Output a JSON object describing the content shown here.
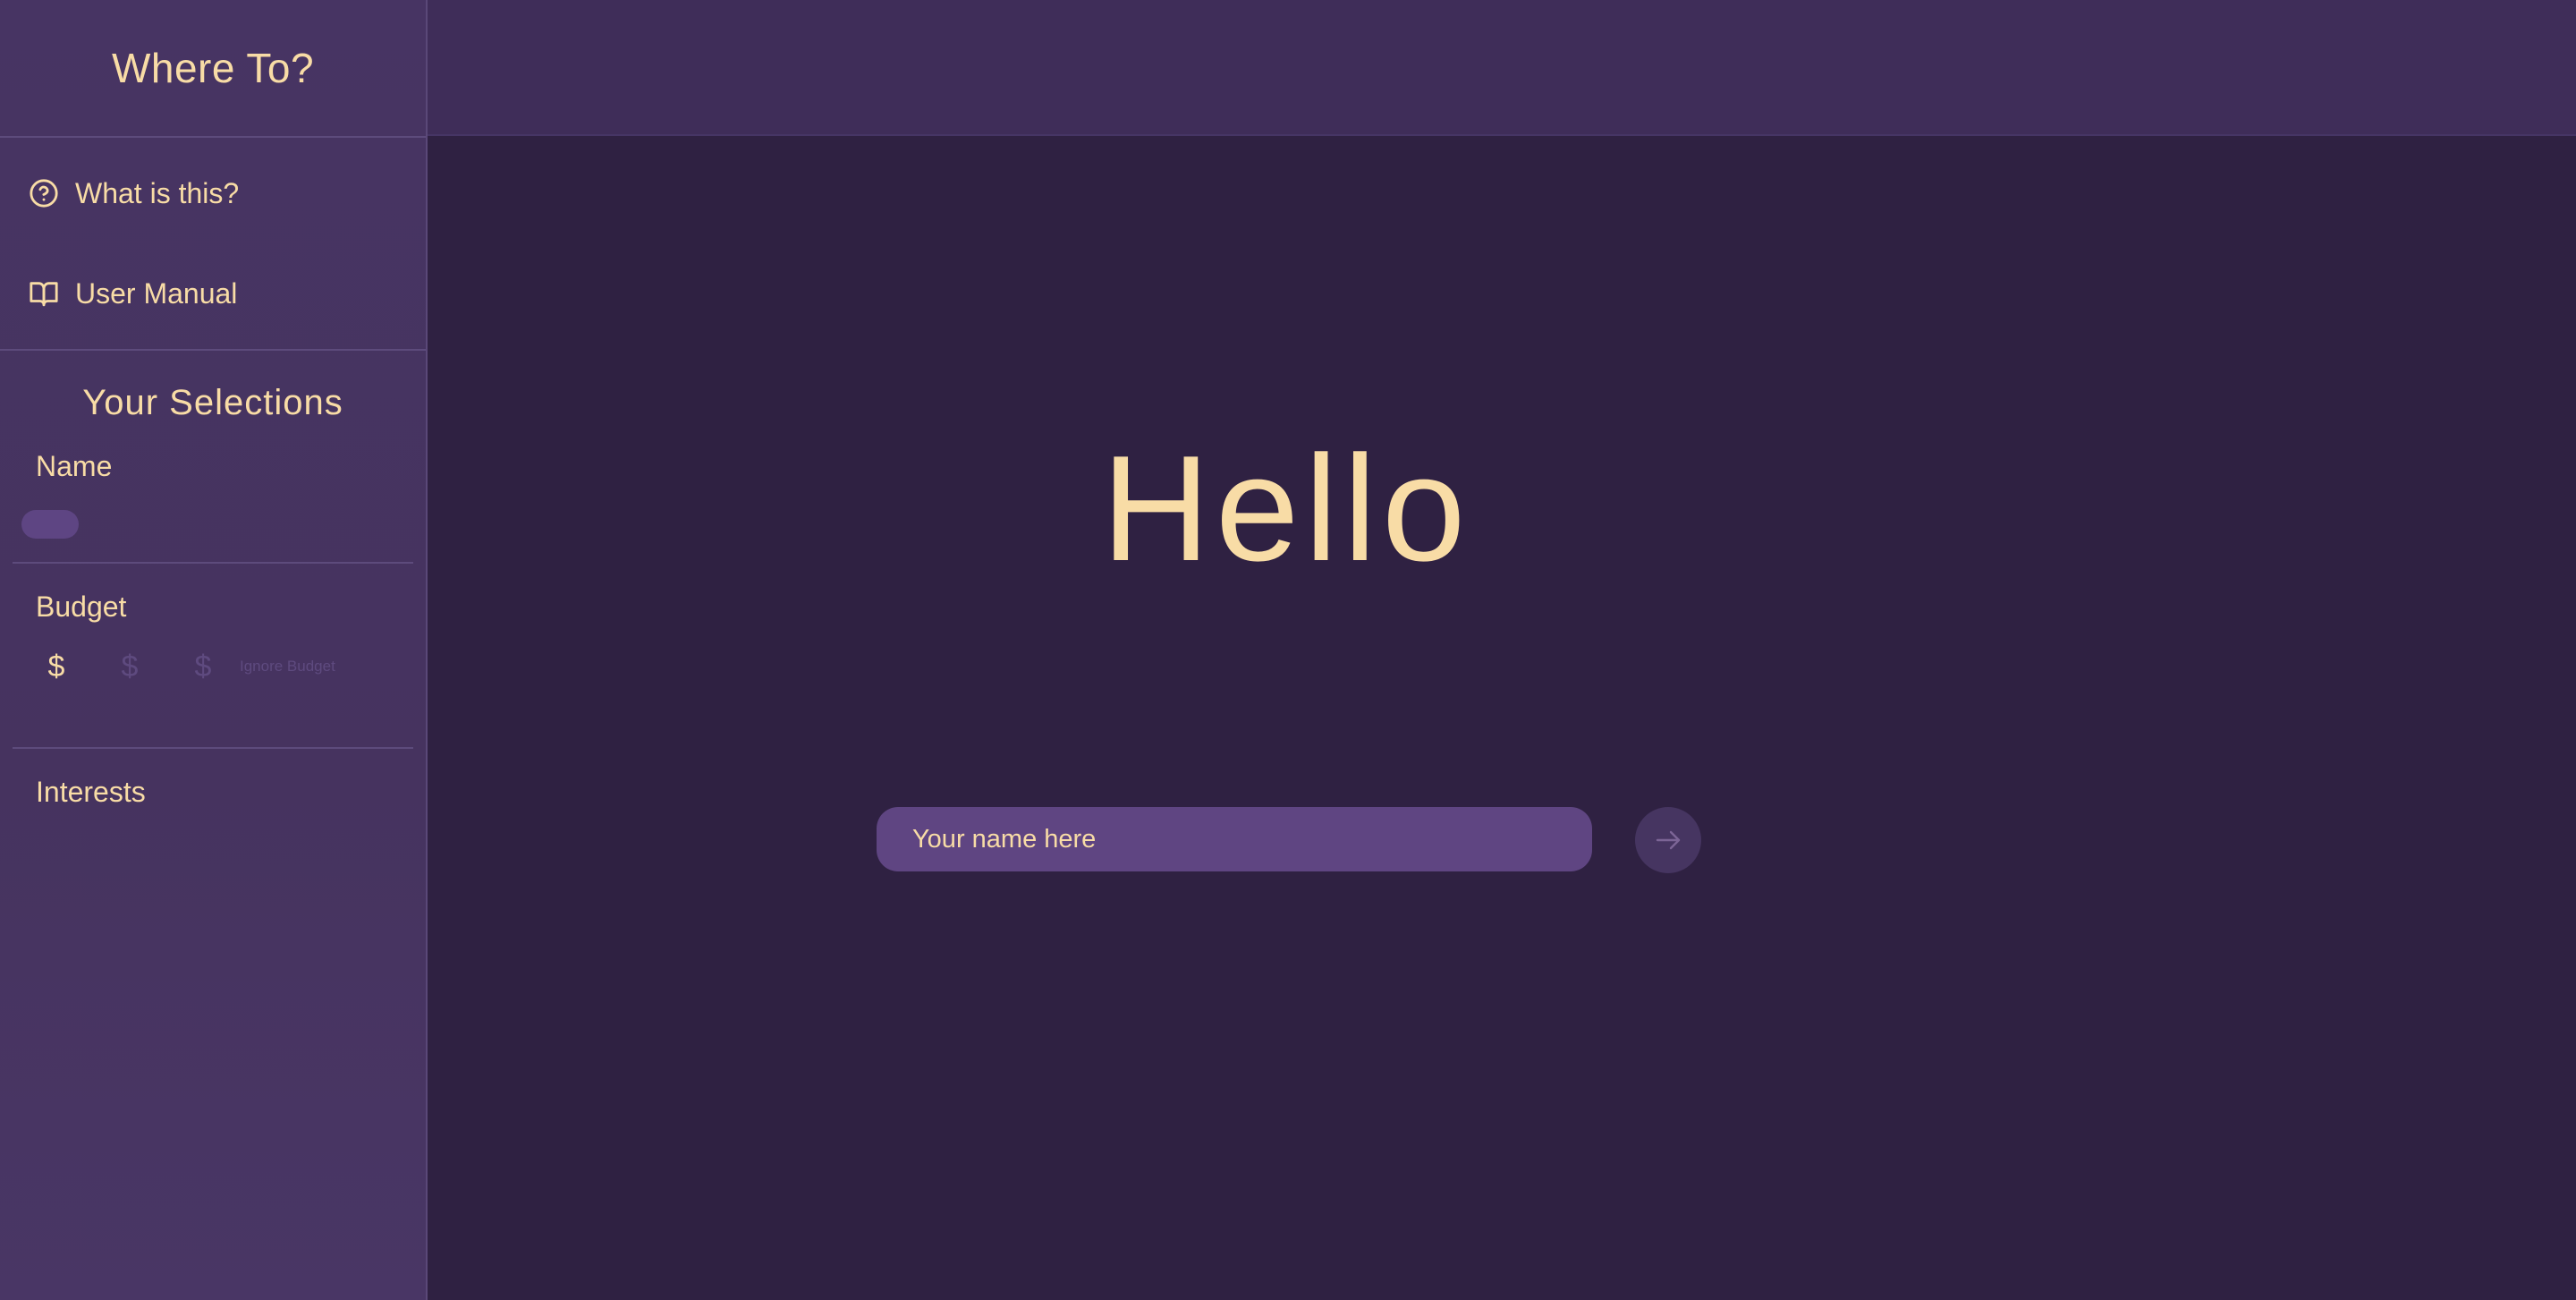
{
  "app": {
    "title": "Where To?"
  },
  "nav": {
    "items": [
      {
        "label": "What is this?",
        "icon": "help-circle-icon"
      },
      {
        "label": "User Manual",
        "icon": "book-open-icon"
      }
    ]
  },
  "selections": {
    "title": "Your Selections",
    "name_label": "Name",
    "budget_label": "Budget",
    "budget_options": [
      "$",
      "$",
      "$"
    ],
    "budget_selected_level": 1,
    "ignore_budget_label": "Ignore Budget",
    "interests_label": "Interests"
  },
  "main": {
    "greeting": "Hello",
    "name_input_placeholder": "Your name here",
    "submit_icon": "arrow-right-icon"
  },
  "colors": {
    "accent_text": "#f8dca6",
    "sidebar_bg": "#473463",
    "main_bg": "#2f2142",
    "topbar_bg": "#3f2d59",
    "input_bg": "#5f4582"
  }
}
